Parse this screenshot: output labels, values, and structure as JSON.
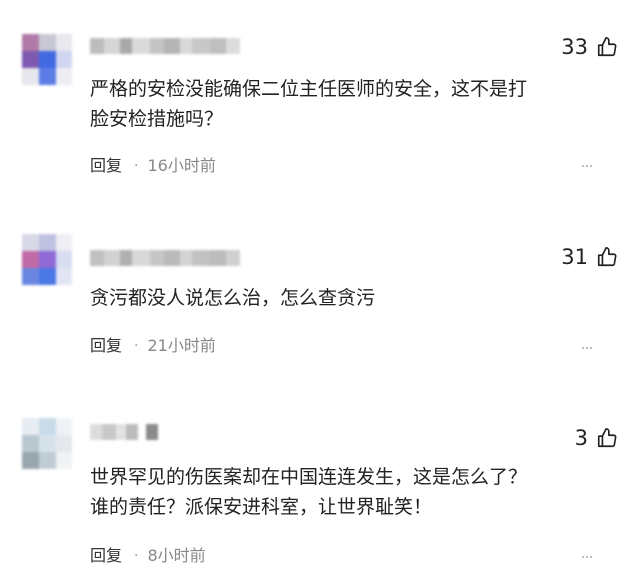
{
  "comments": [
    {
      "likes": "33",
      "text_lines": [
        "严格的安检没能确保二位主任医师的安全，这不是打",
        "脸安检措施吗？"
      ],
      "reply_label": "回复",
      "separator": "·",
      "time": "16小时前",
      "avatar_colors": [
        "#b07aa8",
        "#c9c9d6",
        "#e8e8ee",
        "#7d5ab0",
        "#4169e1",
        "#d0d6f0",
        "#e6e6ec",
        "#5c7de6",
        "#eeeef2"
      ],
      "username_colors": [
        "#bdbdbd",
        "#d6d6d6",
        "#a9a9a9",
        "#dadada",
        "#c4c4c4",
        "#b5b5b5",
        "#d9d9d9",
        "#c8c8c8",
        "#bfbfbf",
        "#dcdcdc"
      ]
    },
    {
      "likes": "31",
      "text_lines": [
        "贪污都没人说怎么治，怎么查贪污"
      ],
      "reply_label": "回复",
      "separator": "·",
      "time": "21小时前",
      "avatar_colors": [
        "#d8d8e6",
        "#bfc2e0",
        "#eeeef4",
        "#c06aa8",
        "#8f6ad6",
        "#d8ddf2",
        "#6a86e0",
        "#4a78e6",
        "#e2e6f4"
      ],
      "username_colors": [
        "#c0c0c0",
        "#d2d2d2",
        "#b0b0b0",
        "#d8d8d8",
        "#c6c6c6",
        "#bababa",
        "#d4d4d4",
        "#c2c2c2",
        "#bcbcbc",
        "#d0d0d0"
      ]
    },
    {
      "likes": "3",
      "text_lines": [
        "世界罕见的伤医案却在中国连连发生，这是怎么了？",
        "谁的责任？派保安进科室，让世界耻笑！"
      ],
      "reply_label": "回复",
      "separator": "·",
      "time": "8小时前",
      "avatar_colors": [
        "#e6ecf2",
        "#c8dbe8",
        "#eef2f6",
        "#b8c8d0",
        "#d6e2ea",
        "#e4e8ec",
        "#9aa6ae",
        "#c0ccd4",
        "#f0f2f4"
      ],
      "username_colors": [
        "#dcdcdc",
        "#c8c8c8",
        "#e2e2e2",
        "#bcbcbc",
        "#ffffff",
        "#8a8a8a",
        "#ffffff",
        "#ffffff",
        "#ffffff",
        "#ffffff"
      ]
    }
  ],
  "icons": {
    "like": "thumbs-up-icon",
    "more": "more-dots-icon"
  },
  "colors": {
    "text": "#222222",
    "meta": "#888888",
    "reply": "#333333"
  }
}
